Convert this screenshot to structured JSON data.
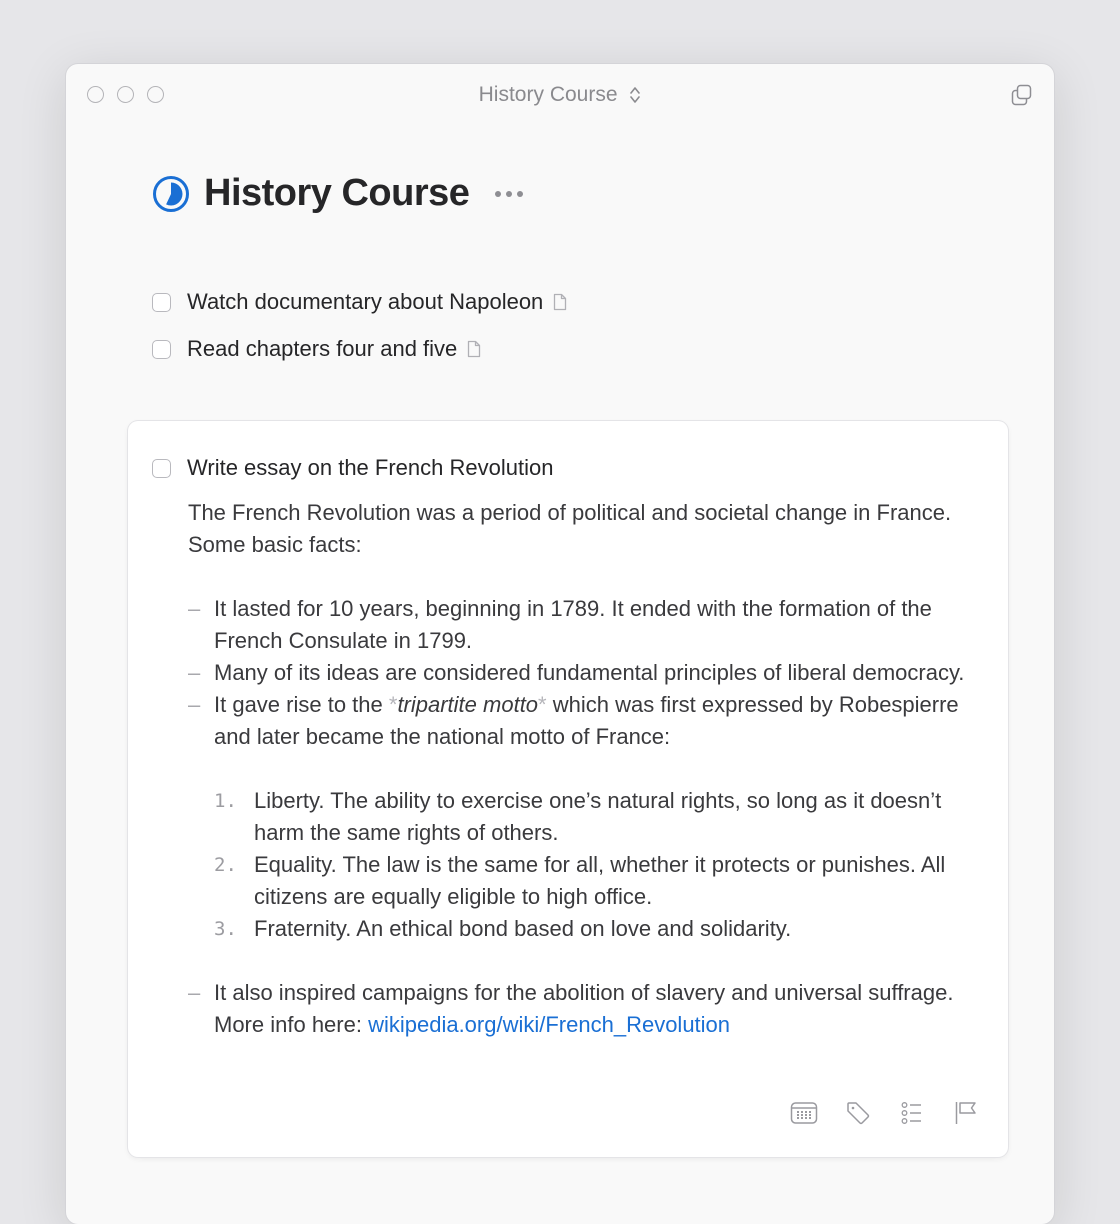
{
  "window": {
    "title": "History Course",
    "title_icon": "chevron-up-down-icon",
    "right_icon": "duplicate-window-icon",
    "traffic_lights": [
      "close",
      "minimize",
      "zoom"
    ]
  },
  "project": {
    "title": "History Course",
    "progress_icon": "pie-progress-icon",
    "progress": 0.57,
    "accent_color": "#1a6fd4",
    "more_icon": "ellipsis-icon"
  },
  "tasks": [
    {
      "title": "Watch documentary about Napoleon",
      "checked": false,
      "has_note": true,
      "note_icon": "note-icon"
    },
    {
      "title": "Read chapters four and five",
      "checked": false,
      "has_note": true,
      "note_icon": "note-icon"
    }
  ],
  "open_task": {
    "title": "Write essay on the French Revolution",
    "checked": false,
    "intro": "The French Revolution was a period of political and societal change in France. Some basic facts:",
    "bullet_marker": "–",
    "bullets": [
      {
        "text": "It lasted for 10 years, beginning in 1789. It ended with the formation of the French Consulate in 1799."
      },
      {
        "text": "Many of its ideas are considered fundamental principles of liberal democracy."
      },
      {
        "pre": "It gave rise to the ",
        "em_marker": "*",
        "em": "tripartite motto",
        "post": " which was first expressed by Robespierre and later became the national motto of France:"
      },
      {
        "pre": "It also inspired campaigns for the abolition of slavery and universal suffrage. More info here: ",
        "link": "wikipedia.org/wiki/French_Revolution"
      }
    ],
    "numbered": [
      {
        "num": "1.",
        "text": "Liberty. The ability to exercise one’s natural rights, so long as it doesn’t harm the same rights of others."
      },
      {
        "num": "2.",
        "text": "Equality. The law is the same for all, whether it protects or punishes. All citizens are equally eligible to high office."
      },
      {
        "num": "3.",
        "text": "Fraternity. An ethical bond based on love and solidarity."
      }
    ],
    "actions": [
      {
        "name": "when",
        "icon": "calendar-icon"
      },
      {
        "name": "tags",
        "icon": "tag-icon"
      },
      {
        "name": "checklist",
        "icon": "checklist-icon"
      },
      {
        "name": "deadline",
        "icon": "flag-icon"
      }
    ]
  }
}
